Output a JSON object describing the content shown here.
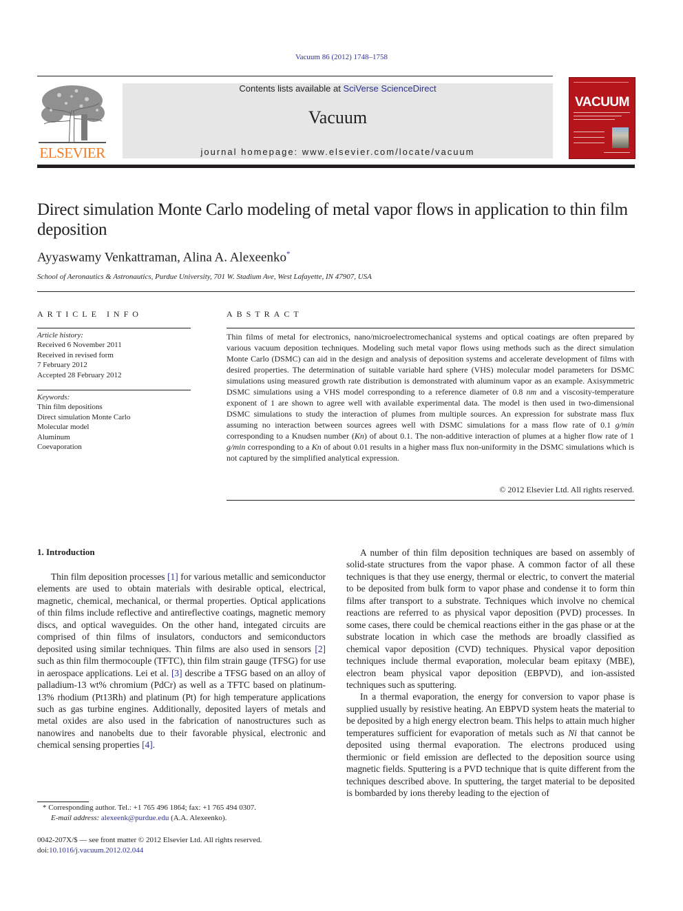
{
  "header": {
    "citation": "Vacuum 86 (2012) 1748–1758",
    "contents_prefix": "Contents lists available at ",
    "contents_link": "SciVerse ScienceDirect",
    "journal_title": "Vacuum",
    "homepage": "journal homepage: www.elsevier.com/locate/vacuum",
    "publisher_logo_text": "ELSEVIER",
    "publisher_logo_icon": "tree-icon",
    "cover_title": "VACUUM",
    "cover_color": "#b5161b",
    "logo_color": "#f47a20",
    "link_color": "#2e3192"
  },
  "article": {
    "title": "Direct simulation Monte Carlo modeling of metal vapor flows in application to thin film deposition",
    "authors": "Ayyaswamy Venkattraman, Alina A. Alexeenko",
    "author_mark": "*",
    "affiliation": "School of Aeronautics & Astronautics, Purdue University, 701 W. Stadium Ave, West Lafayette, IN 47907, USA"
  },
  "article_info": {
    "heading": "ARTICLE INFO",
    "history_label": "Article history:",
    "history": [
      "Received 6 November 2011",
      "Received in revised form",
      "7 February 2012",
      "Accepted 28 February 2012"
    ],
    "keywords_label": "Keywords:",
    "keywords": [
      "Thin film depositions",
      "Direct simulation Monte Carlo",
      "Molecular model",
      "Aluminum",
      "Coevaporation"
    ]
  },
  "abstract": {
    "heading": "ABSTRACT",
    "text_parts": [
      "Thin films of metal for electronics, nano/microelectromechanical systems and optical coatings are often prepared by various vacuum deposition techniques. Modeling such metal vapor flows using methods such as the direct simulation Monte Carlo (DSMC) can aid in the design and analysis of deposition systems and accelerate development of films with desired properties. The determination of suitable variable hard sphere (VHS) molecular model parameters for DSMC simulations using measured growth rate distribution is demonstrated with aluminum vapor as an example. Axisymmetric DSMC simulations using a VHS model corresponding to a reference diameter of 0.8 ",
      "nm",
      " and a viscosity-temperature exponent of 1 are shown to agree well with available experimental data. The model is then used in two-dimensional DSMC simulations to study the interaction of plumes from multiple sources. An expression for substrate mass flux assuming no interaction between sources agrees well with DSMC simulations for a mass flow rate of 0.1 ",
      "g/min",
      " corresponding to a Knudsen number (",
      "Kn",
      ") of about 0.1. The non-additive interaction of plumes at a higher flow rate of 1 ",
      "g/min",
      " corresponding to a ",
      "Kn",
      " of about 0.01 results in a higher mass flux non-uniformity in the DSMC simulations which is not captured by the simplified analytical expression."
    ],
    "copyright": "© 2012 Elsevier Ltd. All rights reserved."
  },
  "body": {
    "section_heading": "1.  Introduction",
    "left_paragraph": {
      "p1": "Thin film deposition processes ",
      "ref1": "[1]",
      "p2": " for various metallic and semiconductor elements are used to obtain materials with desirable optical, electrical, magnetic, chemical, mechanical, or thermal properties. Optical applications of thin films include reflective and antireflective coatings, magnetic memory discs, and optical waveguides. On the other hand, integated circuits are comprised of thin films of insulators, conductors and semiconductors deposited using similar techniques. Thin films are also used in sensors ",
      "ref2": "[2]",
      "p3": " such as thin film thermocouple (TFTC), thin film strain gauge (TFSG) for use in aerospace applications. Lei et al. ",
      "ref3": "[3]",
      "p4": " describe a TFSG based on an alloy of palladium-13 wt% chromium (PdCr) as well as a TFTC based on platinum-13% rhodium (Pt13Rh) and platinum (Pt) for high temperature applications such as gas turbine engines. Additionally, deposited layers of metals and metal oxides are also used in the fabrication of nanostructures such as nanowires and nanobelts due to their favorable physical, electronic and chemical sensing properties ",
      "ref4": "[4]",
      "p5": "."
    },
    "right_paragraph_1": "A number of thin film deposition techniques are based on assembly of solid-state structures from the vapor phase. A common factor of all these techniques is that they use energy, thermal or electric, to convert the material to be deposited from bulk form to vapor phase and condense it to form thin films after transport to a substrate. Techniques which involve no chemical reactions are referred to as physical vapor deposition (PVD) processes. In some cases, there could be chemical reactions either in the gas phase or at the substrate location in which case the methods are broadly classified as chemical vapor deposition (CVD) techniques. Physical vapor deposition techniques include thermal evaporation, molecular beam epitaxy (MBE), electron beam physical vapor deposition (EBPVD), and ion-assisted techniques such as sputtering.",
    "right_paragraph_2": {
      "p1": "In a thermal evaporation, the energy for conversion to vapor phase is supplied usually by resistive heating. An EBPVD system heats the material to be deposited by a high energy electron beam. This helps to attain much higher temperatures sufficient for evaporation of metals such as ",
      "em": "Ni",
      "p2": " that cannot be deposited using thermal evaporation. The electrons produced using thermionic or field emission are deflected to the deposition source using magnetic fields. Sputtering is a PVD technique that is quite different from the techniques described above. In sputtering, the target material to be deposited is bombarded by ions thereby leading to the ejection of"
    }
  },
  "footnote": {
    "mark": "*",
    "line1": " Corresponding author. Tel.: +1 765 496 1864; fax: +1 765 494 0307.",
    "email_label": "E-mail address:",
    "email": "alexeenk@purdue.edu",
    "email_suffix": " (A.A. Alexeenko)."
  },
  "front_matter": {
    "line1": "0042-207X/$ — see front matter © 2012 Elsevier Ltd. All rights reserved.",
    "doi_prefix": "doi:",
    "doi": "10.1016/j.vacuum.2012.02.044"
  }
}
